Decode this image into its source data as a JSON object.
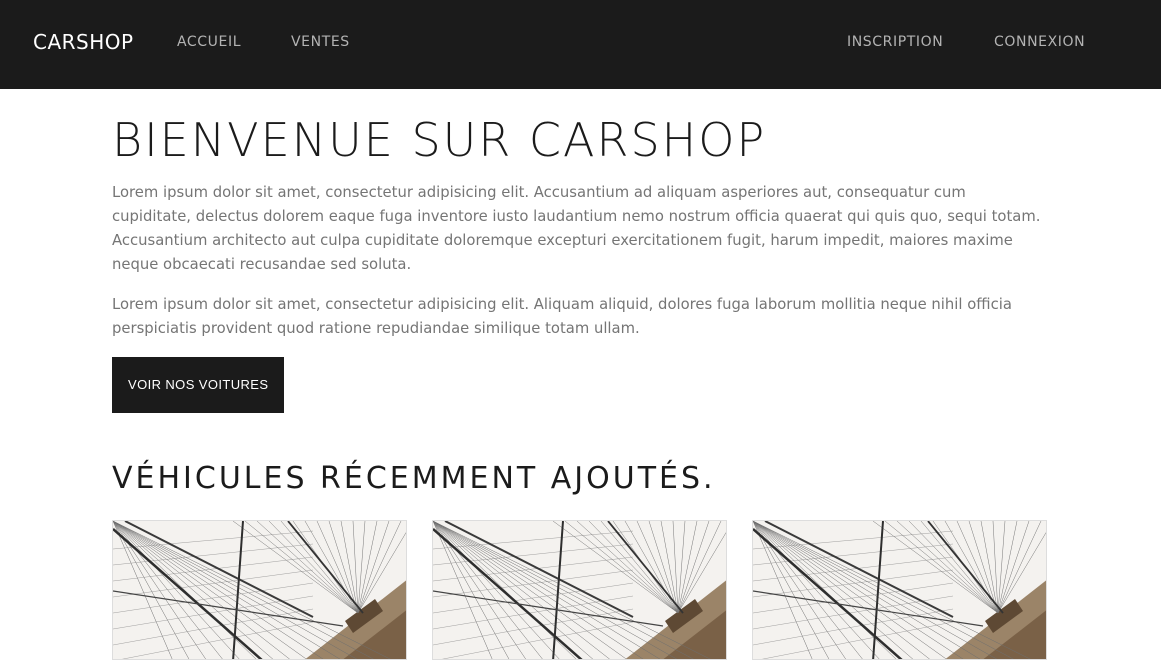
{
  "navbar": {
    "brand": "CARSHOP",
    "links": [
      {
        "label": "ACCUEIL"
      },
      {
        "label": "VENTES"
      },
      {
        "label": "INSCRIPTION"
      },
      {
        "label": "CONNEXION"
      }
    ]
  },
  "hero": {
    "title": "BIENVENUE SUR CARSHOP",
    "paragraphs": [
      "Lorem ipsum dolor sit amet, consectetur adipisicing elit. Accusantium ad aliquam asperiores aut, consequatur cum cupiditate, delectus dolorem eaque fuga inventore iusto laudantium nemo nostrum officia quaerat qui quis quo, sequi totam. Accusantium architecto aut culpa cupiditate doloremque excepturi exercitationem fugit, harum impedit, maiores maxime neque obcaecati recusandae sed soluta.",
      "Lorem ipsum dolor sit amet, consectetur adipisicing elit. Aliquam aliquid, dolores fuga laborum mollitia neque nihil officia perspiciatis provident quod ratione repudiandae similique totam ullam."
    ],
    "cta_label": "VOIR NOS VOITURES"
  },
  "recent": {
    "title": "VÉHICULES RÉCEMMENT AJOUTÉS.",
    "cards": [
      {
        "image": "bridge-cables-photo"
      },
      {
        "image": "bridge-cables-photo"
      },
      {
        "image": "bridge-cables-photo"
      }
    ]
  },
  "colors": {
    "navbar_bg": "#1b1b1b",
    "nav_link": "#b3b3b3",
    "body_text": "#757575",
    "heading": "#1b1b1b",
    "button_bg": "#1b1b1b"
  }
}
